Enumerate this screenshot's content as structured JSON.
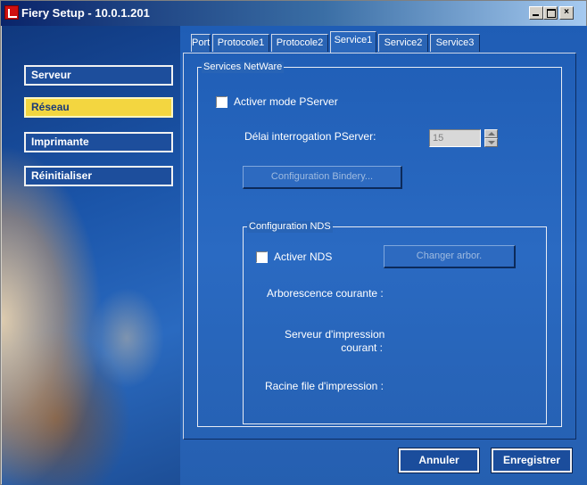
{
  "window": {
    "title": "Fiery Setup - 10.0.1.201"
  },
  "sidebar": {
    "items": [
      {
        "label": "Serveur",
        "active": false
      },
      {
        "label": "Réseau",
        "active": true
      },
      {
        "label": "Imprimante",
        "active": false
      },
      {
        "label": "Réinitialiser",
        "active": false
      }
    ]
  },
  "tabs": [
    "Port",
    "Protocole1",
    "Protocole2",
    "Service1",
    "Service2",
    "Service3"
  ],
  "active_tab": "Service1",
  "netware": {
    "group_title": "Services NetWare",
    "pserver_checkbox_label": "Activer mode PServer",
    "pserver_checked": false,
    "poll_delay_label": "Délai interrogation PServer:",
    "poll_delay_value": "15",
    "bindery_button": "Configuration Bindery..."
  },
  "nds": {
    "group_title": "Configuration NDS",
    "enable_label": "Activer NDS",
    "enable_checked": false,
    "change_tree_button": "Changer arbor.",
    "current_tree_label": "Arborescence courante :",
    "print_server_label_line1": "Serveur d'impression",
    "print_server_label_line2": "courant :",
    "print_queue_root_label": "Racine file d'impression :"
  },
  "footer": {
    "cancel_label": "Annuler",
    "save_label": "Enregistrer"
  },
  "colors": {
    "background": "#1f5db5",
    "active_nav": "#f3d640",
    "title_bar": "#0a246a"
  }
}
